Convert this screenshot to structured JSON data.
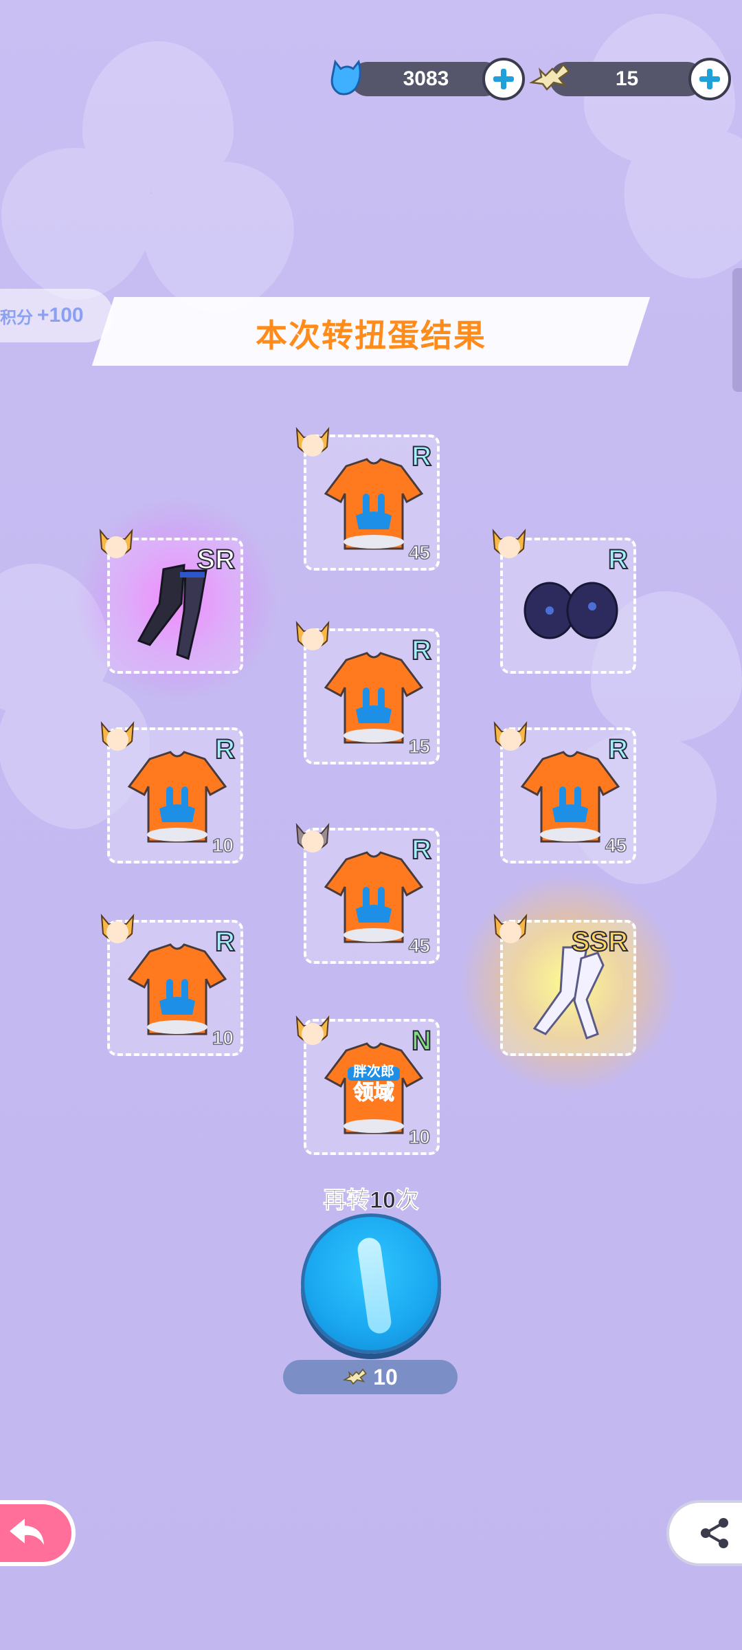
{
  "currencies": [
    {
      "name": "gems",
      "icon": "blue-cat-gem-icon",
      "value": "3083"
    },
    {
      "name": "fish-bones",
      "icon": "fish-bone-icon",
      "value": "15"
    }
  ],
  "score": {
    "label": "积分",
    "value": "+100"
  },
  "result_title": "本次转扭蛋结果",
  "items": [
    {
      "rarity": "SR",
      "count": "",
      "item": "black-stockings",
      "avatar": "cat-girl-orange"
    },
    {
      "rarity": "R",
      "count": "45",
      "item": "orange-tshirt-bunny",
      "avatar": "cat-girl-orange"
    },
    {
      "rarity": "R",
      "count": "",
      "item": "dark-gloves",
      "avatar": "cat-girl-orange"
    },
    {
      "rarity": "R",
      "count": "15",
      "item": "orange-tshirt-bunny",
      "avatar": "cat-girl-orange"
    },
    {
      "rarity": "R",
      "count": "10",
      "item": "orange-tshirt-bunny",
      "avatar": "cat-girl-orange"
    },
    {
      "rarity": "R",
      "count": "45",
      "item": "orange-tshirt-bunny",
      "avatar": "cat-girl-orange"
    },
    {
      "rarity": "R",
      "count": "45",
      "item": "orange-tshirt-bunny",
      "avatar": "cat-girl-grey"
    },
    {
      "rarity": "R",
      "count": "10",
      "item": "orange-tshirt-bunny",
      "avatar": "cat-girl-orange"
    },
    {
      "rarity": "SSR",
      "count": "",
      "item": "white-stockings",
      "avatar": "cat-girl-orange"
    },
    {
      "rarity": "N",
      "count": "10",
      "item": "orange-tshirt-text",
      "avatar": "cat-girl-orange"
    }
  ],
  "shirt_text_lines": [
    "胖次郎",
    "领域"
  ],
  "spin_again_label": "再转10次",
  "spin_cost": "10"
}
